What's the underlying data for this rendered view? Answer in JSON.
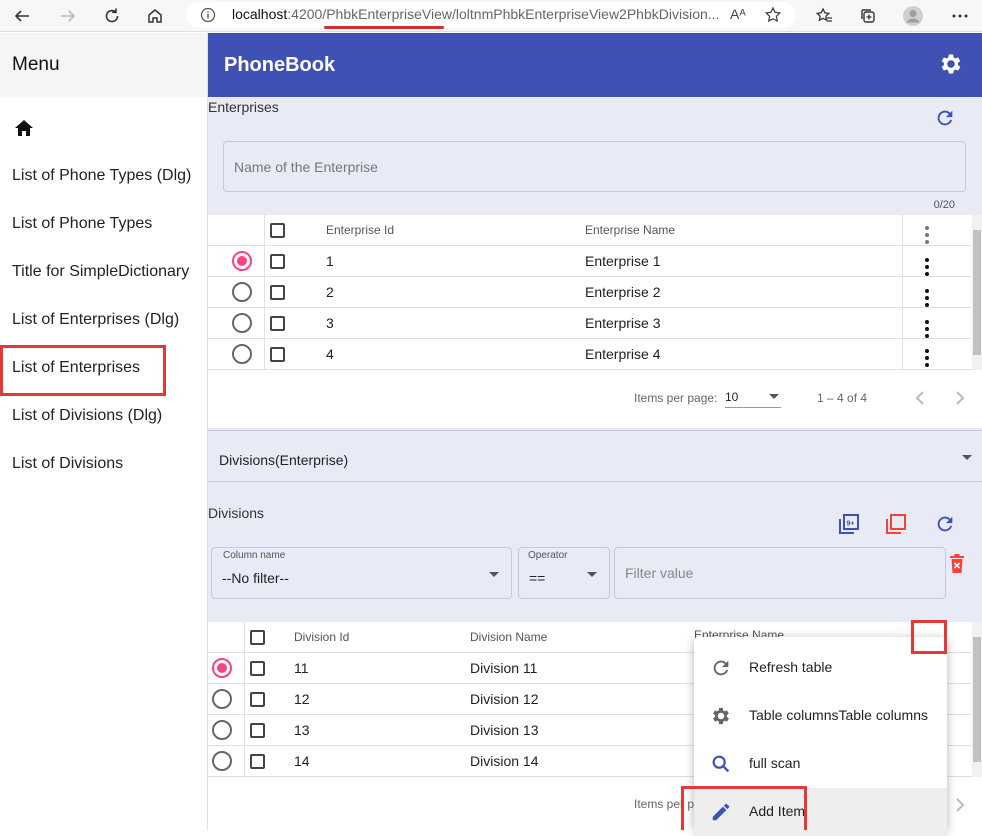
{
  "browser": {
    "url_host": "localhost",
    "url_port": ":4200/",
    "url_path": "PhbkEnterpriseView/loltnmPhbkEnterpriseView2PhbkDivision...",
    "read_aloud": "Aᴬ"
  },
  "sidebar": {
    "title": "Menu",
    "items": [
      {
        "label": "List of Phone Types (Dlg)"
      },
      {
        "label": "List of Phone Types"
      },
      {
        "label": "Title for SimpleDictionary"
      },
      {
        "label": "List of Enterprises (Dlg)"
      },
      {
        "label": "List of Enterprises"
      },
      {
        "label": "List of Divisions (Dlg)"
      },
      {
        "label": "List of Divisions"
      }
    ]
  },
  "app": {
    "title": "PhoneBook"
  },
  "enterprises": {
    "section_label": "Enterprises",
    "search_placeholder": "Name of the Enterprise",
    "counter": "0/20",
    "columns": [
      "Enterprise Id",
      "Enterprise Name"
    ],
    "rows": [
      {
        "id": "1",
        "name": "Enterprise 1",
        "selected": true
      },
      {
        "id": "2",
        "name": "Enterprise 2",
        "selected": false
      },
      {
        "id": "3",
        "name": "Enterprise 3",
        "selected": false
      },
      {
        "id": "4",
        "name": "Enterprise 4",
        "selected": false
      }
    ],
    "pager": {
      "label": "Items per page:",
      "size": "10",
      "range": "1 – 4 of 4"
    }
  },
  "divisions_select": {
    "label": "Divisions(Enterprise)"
  },
  "divisions": {
    "section_label": "Divisions",
    "filter": {
      "column_label": "Column name",
      "column_value": "--No filter--",
      "operator_label": "Operator",
      "operator_value": "==",
      "value_placeholder": "Filter value"
    },
    "columns": [
      "Division Id",
      "Division Name",
      "Enterprise Name"
    ],
    "rows": [
      {
        "id": "11",
        "name": "Division 11",
        "selected": true
      },
      {
        "id": "12",
        "name": "Division 12",
        "selected": false
      },
      {
        "id": "13",
        "name": "Division 13",
        "selected": false
      },
      {
        "id": "14",
        "name": "Division 14",
        "selected": false
      }
    ],
    "pager_label": "Items per p"
  },
  "context_menu": {
    "items": [
      {
        "label": "Refresh table",
        "icon": "refresh-icon"
      },
      {
        "label": "Table columnsTable columns",
        "icon": "gear-icon"
      },
      {
        "label": "full scan",
        "icon": "search-icon"
      },
      {
        "label": "Add Item",
        "icon": "pencil-icon"
      }
    ]
  },
  "colors": {
    "primary": "#3f51b5",
    "accent": "#ff4081",
    "panel": "#e8eaf6",
    "highlight": "#e53935",
    "warn": "#f44336"
  }
}
